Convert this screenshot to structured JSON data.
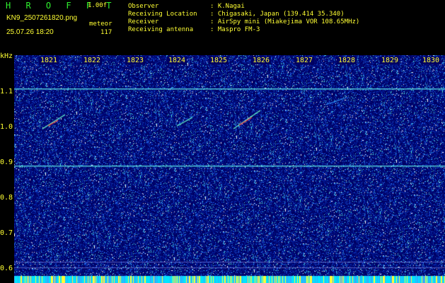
{
  "header": {
    "app_title": "H R O F F T",
    "version": "1.00f",
    "filename": "KN9_2507261820.png",
    "meteor_label": "meteor",
    "meteor_count": "117",
    "datetime": "25.07.26 18:20",
    "info": [
      {
        "key": "Observer",
        "value": ": K.Nagai"
      },
      {
        "key": "Receiving Location",
        "value": ": Chigasaki, Japan (139.414 35.340)"
      },
      {
        "key": "Receiver",
        "value": ": AirSpy mini (Miakejima VOR 108.65MHz)"
      },
      {
        "key": "Receiving antenna",
        "value": ": Maspro FM-3"
      }
    ]
  },
  "axis": {
    "y_unit": "kHz",
    "y_ticks": [
      "1.1",
      "1.0",
      "0.9",
      "0.8",
      "0.7",
      "0.6"
    ],
    "x_ticks": [
      "1821",
      "1822",
      "1823",
      "1824",
      "1825",
      "1826",
      "1827",
      "1828",
      "1829",
      "1830"
    ]
  },
  "colors": {
    "background": "#000063",
    "label": "#ffff33",
    "title": "#2ff22f",
    "carrier": "#5ce6e6",
    "meteor_echo": "#ff3333"
  }
}
